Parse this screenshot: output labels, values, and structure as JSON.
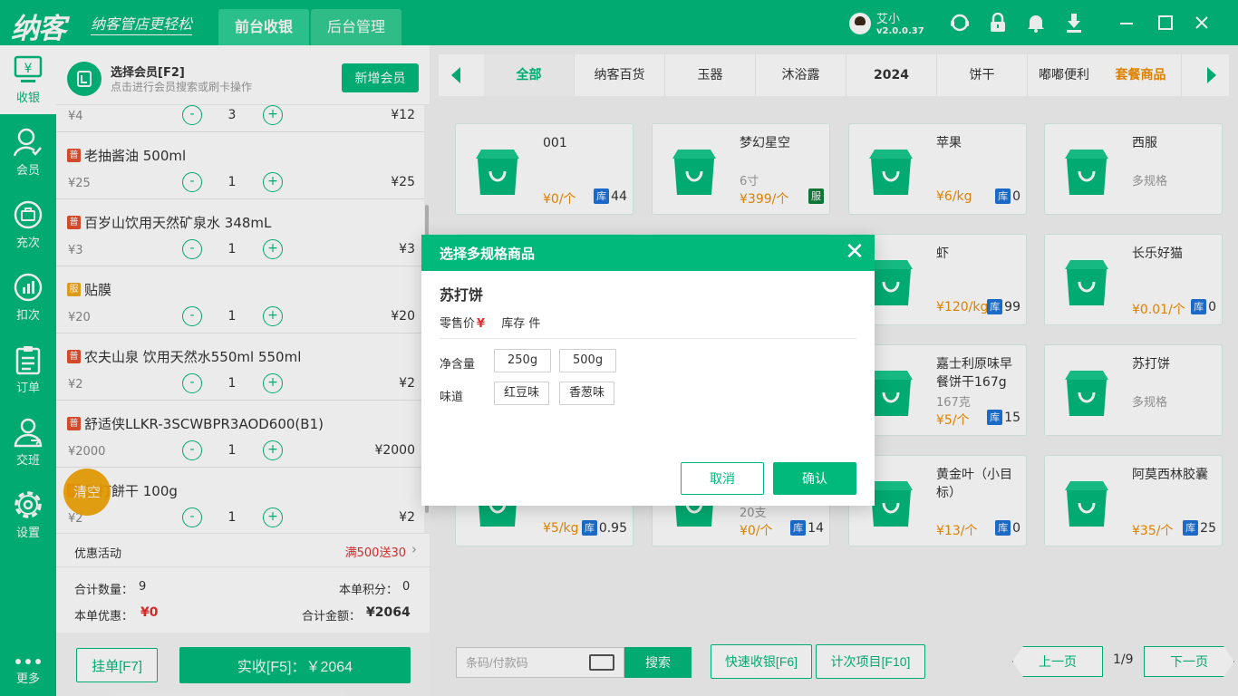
{
  "app": {
    "logo": "纳客",
    "slogan": "纳客管店更轻松",
    "tabs": [
      "前台收银",
      "后台管理"
    ],
    "user_name": "艾小",
    "version": "v2.0.0.37"
  },
  "sidebar": {
    "items": [
      {
        "label": "收银",
        "icon": "cashier-icon"
      },
      {
        "label": "会员",
        "icon": "member-icon"
      },
      {
        "label": "充次",
        "icon": "recharge-icon"
      },
      {
        "label": "扣次",
        "icon": "deduct-icon"
      },
      {
        "label": "订单",
        "icon": "order-icon"
      },
      {
        "label": "交班",
        "icon": "shift-icon"
      },
      {
        "label": "设置",
        "icon": "settings-icon"
      },
      {
        "label": "更多",
        "icon": "more-icon"
      }
    ]
  },
  "member": {
    "title": "选择会员[F2]",
    "hint": "点击进行会员搜索或刷卡操作",
    "add_button": "新增会员"
  },
  "cart": {
    "partial_row": {
      "price": "¥4",
      "qty": "3",
      "total": "¥12"
    },
    "items": [
      {
        "badge": "普",
        "name": "老抽酱油 500ml",
        "price": "¥25",
        "qty": "1",
        "total": "¥25"
      },
      {
        "badge": "普",
        "name": "百岁山饮用天然矿泉水 348mL",
        "price": "¥3",
        "qty": "1",
        "total": "¥3"
      },
      {
        "badge": "服",
        "name": "贴膜",
        "price": "¥20",
        "qty": "1",
        "total": "¥20"
      },
      {
        "badge": "普",
        "name": "农夫山泉 饮用天然水550ml 550ml",
        "price": "¥2",
        "qty": "1",
        "total": "¥2"
      },
      {
        "badge": "普",
        "name": "舒适侠LLKR-3SCWBPR3AOD600(B1)",
        "price": "¥2000",
        "qty": "1",
        "total": "¥2000"
      },
      {
        "badge": "普",
        "name": "苏打餅干 100g",
        "price": "¥2",
        "qty": "1",
        "total": "¥2"
      }
    ],
    "minus": "-",
    "plus": "+",
    "clear_button": "清空"
  },
  "promo": {
    "label": "优惠活动",
    "value": "满500送30"
  },
  "summary": {
    "qty_label": "合计数量：",
    "qty_value": "9",
    "points_label": "本单积分：",
    "points_value": "0",
    "discount_label": "本单优惠：",
    "discount_value": "¥0",
    "amount_label": "合计金额：",
    "amount_value": "¥2064"
  },
  "footer_left": {
    "hold": "挂单[F7]",
    "pay": "实收[F5]：￥2064"
  },
  "categories": [
    "全部",
    "纳客百货",
    "玉器",
    "沐浴露",
    "2024",
    "饼干",
    "嘟嘟便利",
    "套餐商品"
  ],
  "products": [
    {
      "name": "001",
      "sub": "",
      "price": "¥0/个",
      "stock": "44",
      "tag": "库"
    },
    {
      "name": "梦幻星空",
      "sub": "6寸",
      "price": "¥399/个",
      "stock": "",
      "tag": "服"
    },
    {
      "name": "苹果",
      "sub": "",
      "price": "¥6/kg",
      "stock": "0",
      "tag": "库"
    },
    {
      "name": "西服",
      "sub": "多规格",
      "price": "",
      "stock": "",
      "tag": ""
    },
    {
      "name": "",
      "sub": "",
      "price": "",
      "stock": "",
      "tag": ""
    },
    {
      "name": "",
      "sub": "",
      "price": "",
      "stock": "",
      "tag": ""
    },
    {
      "name": "虾",
      "sub": "",
      "price": "¥120/kg",
      "stock": "99",
      "tag": "库"
    },
    {
      "name": "长乐好猫",
      "sub": "",
      "price": "¥0.01/个",
      "stock": "0",
      "tag": "库"
    },
    {
      "name": "",
      "sub": "",
      "price": "",
      "stock": "",
      "tag": ""
    },
    {
      "name": "",
      "sub": "",
      "price": "",
      "stock": "",
      "tag": ""
    },
    {
      "name": "嘉士利原味早餐饼干167g",
      "sub": "167克",
      "price": "¥5/个",
      "stock": "15",
      "tag": "库"
    },
    {
      "name": "苏打饼",
      "sub": "多规格",
      "price": "",
      "stock": "",
      "tag": ""
    },
    {
      "name": "",
      "sub": "",
      "price": "¥5/kg",
      "stock": "0.95",
      "tag": "库"
    },
    {
      "name": "",
      "sub": "20支",
      "price": "¥0/个",
      "stock": "14",
      "tag": "库"
    },
    {
      "name": "黄金叶（小目标）",
      "sub": "",
      "price": "¥13/个",
      "stock": "0",
      "tag": "库"
    },
    {
      "name": "阿莫西林胶囊",
      "sub": "",
      "price": "¥35/个",
      "stock": "25",
      "tag": "库"
    }
  ],
  "bottom": {
    "barcode_placeholder": "条码/付款码",
    "search": "搜索",
    "quick_pay": "快速收银[F6]",
    "count_item": "计次项目[F10]",
    "prev": "上一页",
    "page": "1/9",
    "next": "下一页"
  },
  "modal": {
    "title": "选择多规格商品",
    "product": "苏打饼",
    "price_label": "零售价",
    "price_symbol": "¥",
    "stock_label": "库存 件",
    "spec1_label": "净含量",
    "spec1_options": [
      "250g",
      "500g"
    ],
    "spec2_label": "味道",
    "spec2_options": [
      "红豆味",
      "香葱味"
    ],
    "cancel": "取消",
    "confirm": "确认"
  },
  "colors": {
    "accent": "#00b97a",
    "orange": "#f08c00",
    "red": "#e62e2e",
    "stock_blue": "#1e73d8"
  }
}
